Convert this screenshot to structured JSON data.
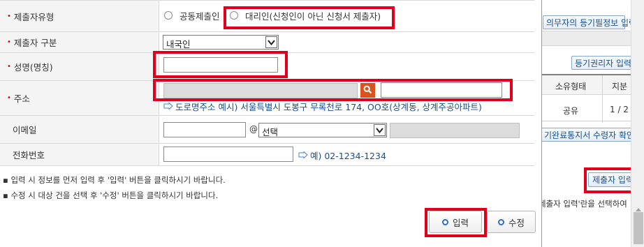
{
  "form": {
    "submitter_type": {
      "label": "제출자유형",
      "option_joint": "공동제출인",
      "option_agent": "대리인(신청인이 아닌 신청서 제출자)"
    },
    "submitter_category": {
      "label": "제출자 구분",
      "selected": "내국인"
    },
    "name": {
      "label": "성명(명칭)",
      "value": ""
    },
    "address": {
      "label": "주소",
      "detail_value": "",
      "example_hint": "도로명주소 예시) 서울특별시 도봉구 무록천로 174, OO호(상계동, 상계주공아파트)"
    },
    "email": {
      "label": "이메일",
      "at_sign": "@",
      "domain_selected": "선택"
    },
    "phone": {
      "label": "전화번호",
      "example_hint": "예) 02-1234-1234"
    }
  },
  "notes": [
    "입력 시 정보를 먼저 입력 후 '입력' 버튼을 클릭하시기 바랍니다.",
    "수정 시 대상 건을 선택 후 '수정' 버튼을 클릭하시기 바랍니다."
  ],
  "buttons": {
    "input_label": "입력",
    "edit_label": "수정"
  },
  "side": {
    "obligor_registry_button": "의무자의 등기필정보 입력",
    "right_holder_button": "등기권리자 입력",
    "col_ownership": "소유형태",
    "col_share": "지분",
    "row_ownership": "공유",
    "row_share": "1 / 2",
    "notice_receiver_button": "기완료통지서 수령자 확인",
    "submitter_input_button": "제출자 입력",
    "instruction_text": "세출자 입력'란을 선택하여"
  },
  "colors": {
    "highlight": "#e0001b",
    "required_mark": "#d0021b",
    "link_blue": "#1c4e8f",
    "search_orange": "#d9531e"
  }
}
